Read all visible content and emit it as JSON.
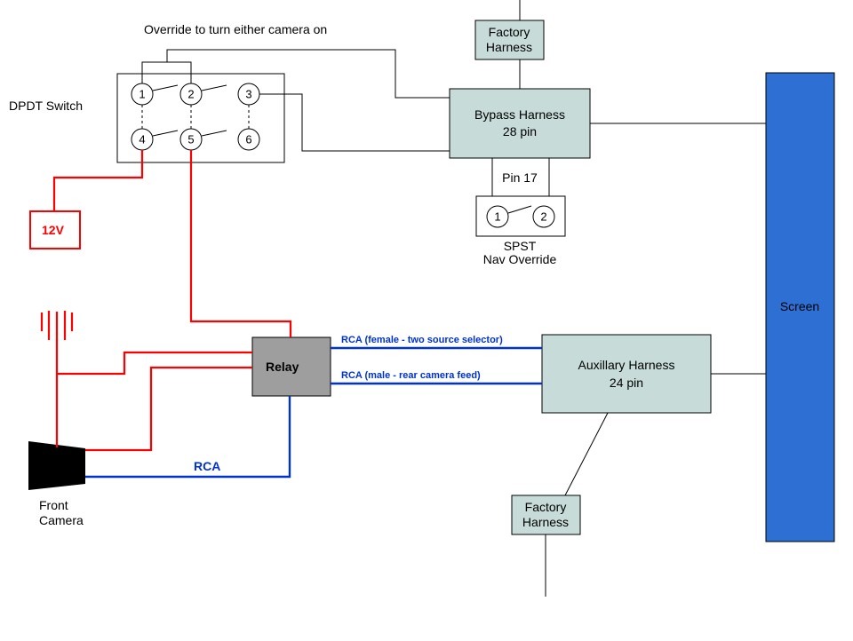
{
  "title_override": "Override to turn either camera on",
  "dpdt": {
    "label": "DPDT Switch",
    "pins": [
      "1",
      "2",
      "3",
      "4",
      "5",
      "6"
    ]
  },
  "twelveV": "12V",
  "bypass": {
    "line1": "Bypass Harness",
    "line2": "28 pin",
    "pin17": "Pin 17"
  },
  "factory_top": {
    "line1": "Factory",
    "line2": "Harness"
  },
  "factory_bot": {
    "line1": "Factory",
    "line2": "Harness"
  },
  "spst": {
    "pins": [
      "1",
      "2"
    ],
    "line1": "SPST",
    "line2": "Nav Override"
  },
  "screen": "Screen",
  "relay": "Relay",
  "rca_top": "RCA (female - two source selector)",
  "rca_bot": "RCA (male - rear camera feed)",
  "rca_cam": "RCA",
  "aux": {
    "line1": "Auxillary Harness",
    "line2": "24 pin"
  },
  "front_cam": {
    "line1": "Front",
    "line2": "Camera"
  }
}
